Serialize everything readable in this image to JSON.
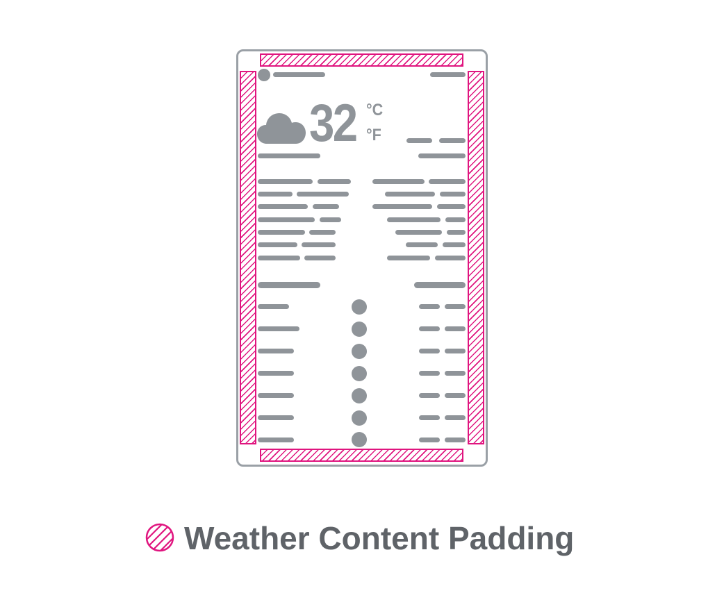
{
  "weather": {
    "temperature": "32",
    "unit_celsius": "°C",
    "unit_fahrenheit": "°F",
    "condition_icon": "cloud-icon"
  },
  "legend": {
    "label": "Weather Content Padding",
    "icon": "hatched-circle-icon",
    "hatch_color": "#e0157f",
    "text_color": "#5f6368"
  },
  "colors": {
    "placeholder": "#8f9499",
    "frame": "#9aa0a6",
    "padding_highlight": "#e0157f"
  }
}
